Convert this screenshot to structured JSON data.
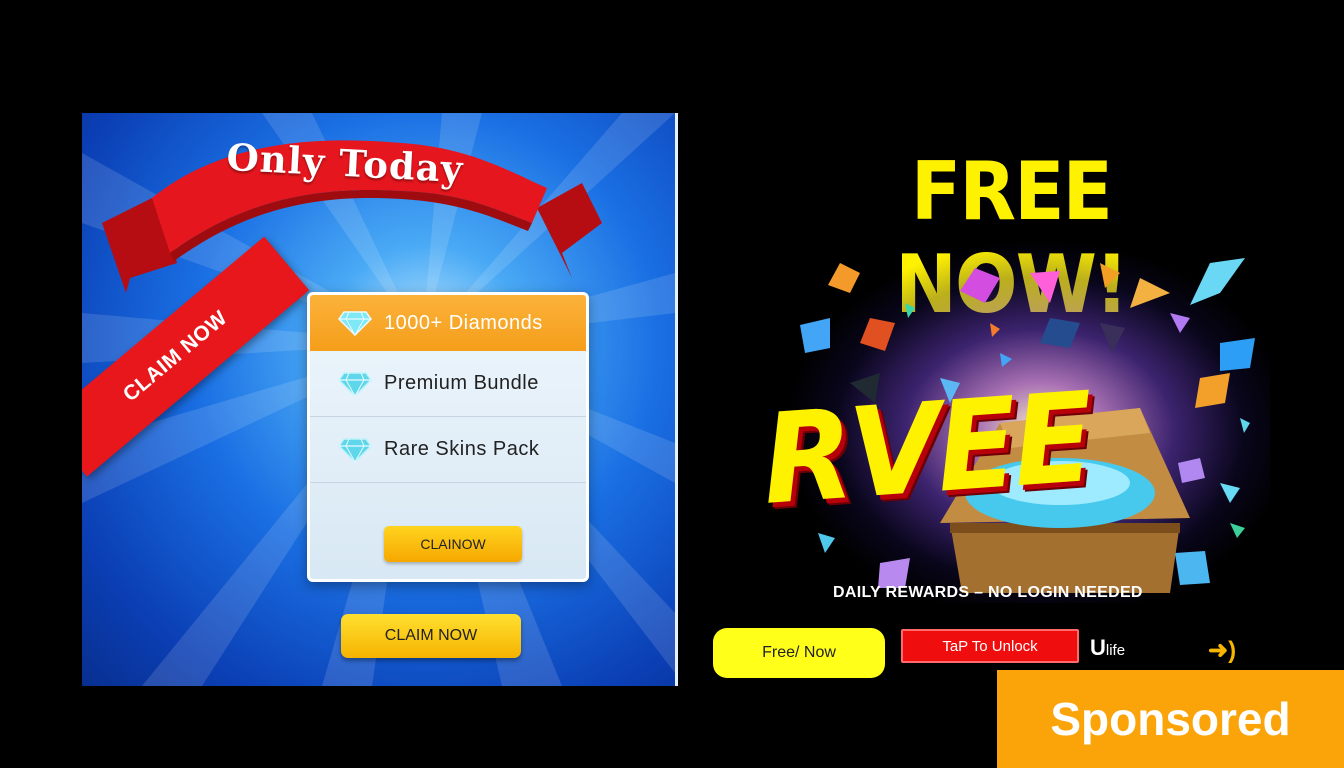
{
  "left_ad": {
    "ribbon_text": "Only Today",
    "diagonal_banner": "CLAIM NOW",
    "offers": [
      {
        "label": "1000+ Diamonds",
        "highlighted": true,
        "icon": "diamond-icon"
      },
      {
        "label": "Premium Bundle",
        "highlighted": false,
        "icon": "diamond-icon"
      },
      {
        "label": "Rare Skins  Pack",
        "highlighted": false,
        "icon": "diamond-icon"
      }
    ],
    "card_button": "CLAINOW",
    "main_button": "CLAIM NOW"
  },
  "right_ad": {
    "headline": "FREE NOW!",
    "big_word": "RVEE",
    "subline": "DAILY REWARDS – NO LOGIN NEEDED",
    "free_button": "Free/ Now",
    "unlock_button": "TaP To Unlock",
    "brand_main": "U",
    "brand_sub": "life",
    "arrow_icon": "➜)"
  },
  "sponsored_label": "Sponsored",
  "colors": {
    "yellow": "#fff200",
    "red": "#e8171c",
    "orange": "#fba40a",
    "blue": "#1a6fe3"
  }
}
